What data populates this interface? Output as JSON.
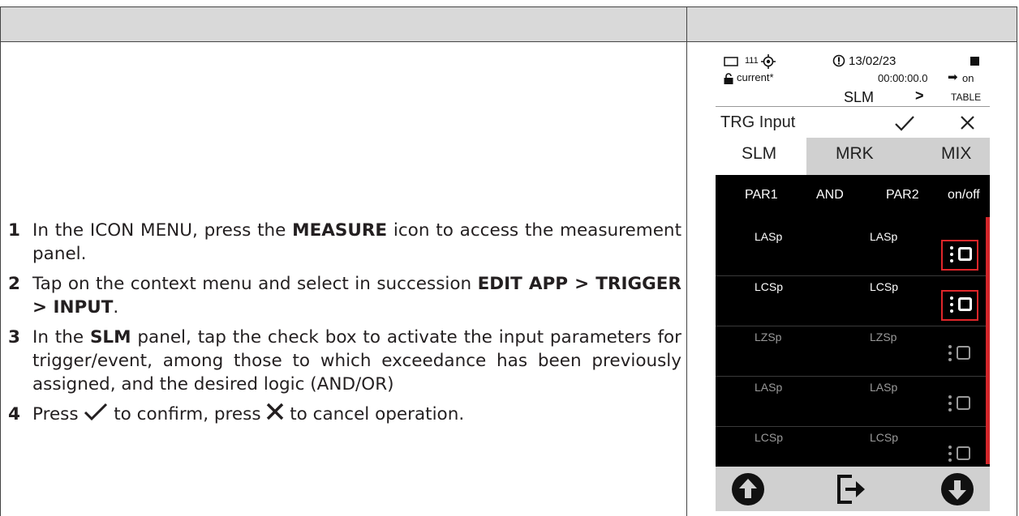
{
  "steps": [
    {
      "num": "1",
      "parts": [
        "In the ICON MENU, press the ",
        "MEASURE",
        " icon to access the measurement panel."
      ]
    },
    {
      "num": "2",
      "parts": [
        "Tap on the context menu and select in succession ",
        "EDIT APP > TRIGGER > INPUT",
        "."
      ]
    },
    {
      "num": "3",
      "parts": [
        "In the ",
        "SLM",
        " panel, tap the check box to activate the input parameters for trigger/event, among those to which exceedance has been previously assigned, and the desired logic (AND/OR)"
      ]
    },
    {
      "num": "4",
      "press": "Press ",
      "confirm_text": " to confirm, press ",
      "cancel_text": " to cancel operation."
    }
  ],
  "device": {
    "status_counter": "111",
    "date": "13/02/23",
    "profile": "current*",
    "time": "00:00:00.0",
    "time_state": "on",
    "crumb_from": "SLM",
    "crumb_sep": ">",
    "crumb_to": "TABLE",
    "title": "TRG Input",
    "confirm_icon": "check-icon",
    "cancel_icon": "x-icon",
    "tabs": [
      "SLM",
      "MRK",
      "MIX"
    ],
    "active_tab": "SLM",
    "columns": [
      "PAR1",
      "AND",
      "PAR2",
      "on/off"
    ],
    "rows": [
      {
        "par1": "LASp",
        "par2": "LASp",
        "active": true
      },
      {
        "par1": "LCSp",
        "par2": "LCSp",
        "active": true
      },
      {
        "par1": "LZSp",
        "par2": "LZSp",
        "active": false
      },
      {
        "par1": "LASp",
        "par2": "LASp",
        "active": false
      },
      {
        "par1": "LCSp",
        "par2": "LCSp",
        "active": false
      }
    ],
    "bottom_icons": [
      "arrow-up-circle-icon",
      "exit-icon",
      "arrow-down-circle-icon"
    ]
  },
  "colors": {
    "highlight": "#e0262a",
    "header_bg": "#d9d9d9"
  }
}
